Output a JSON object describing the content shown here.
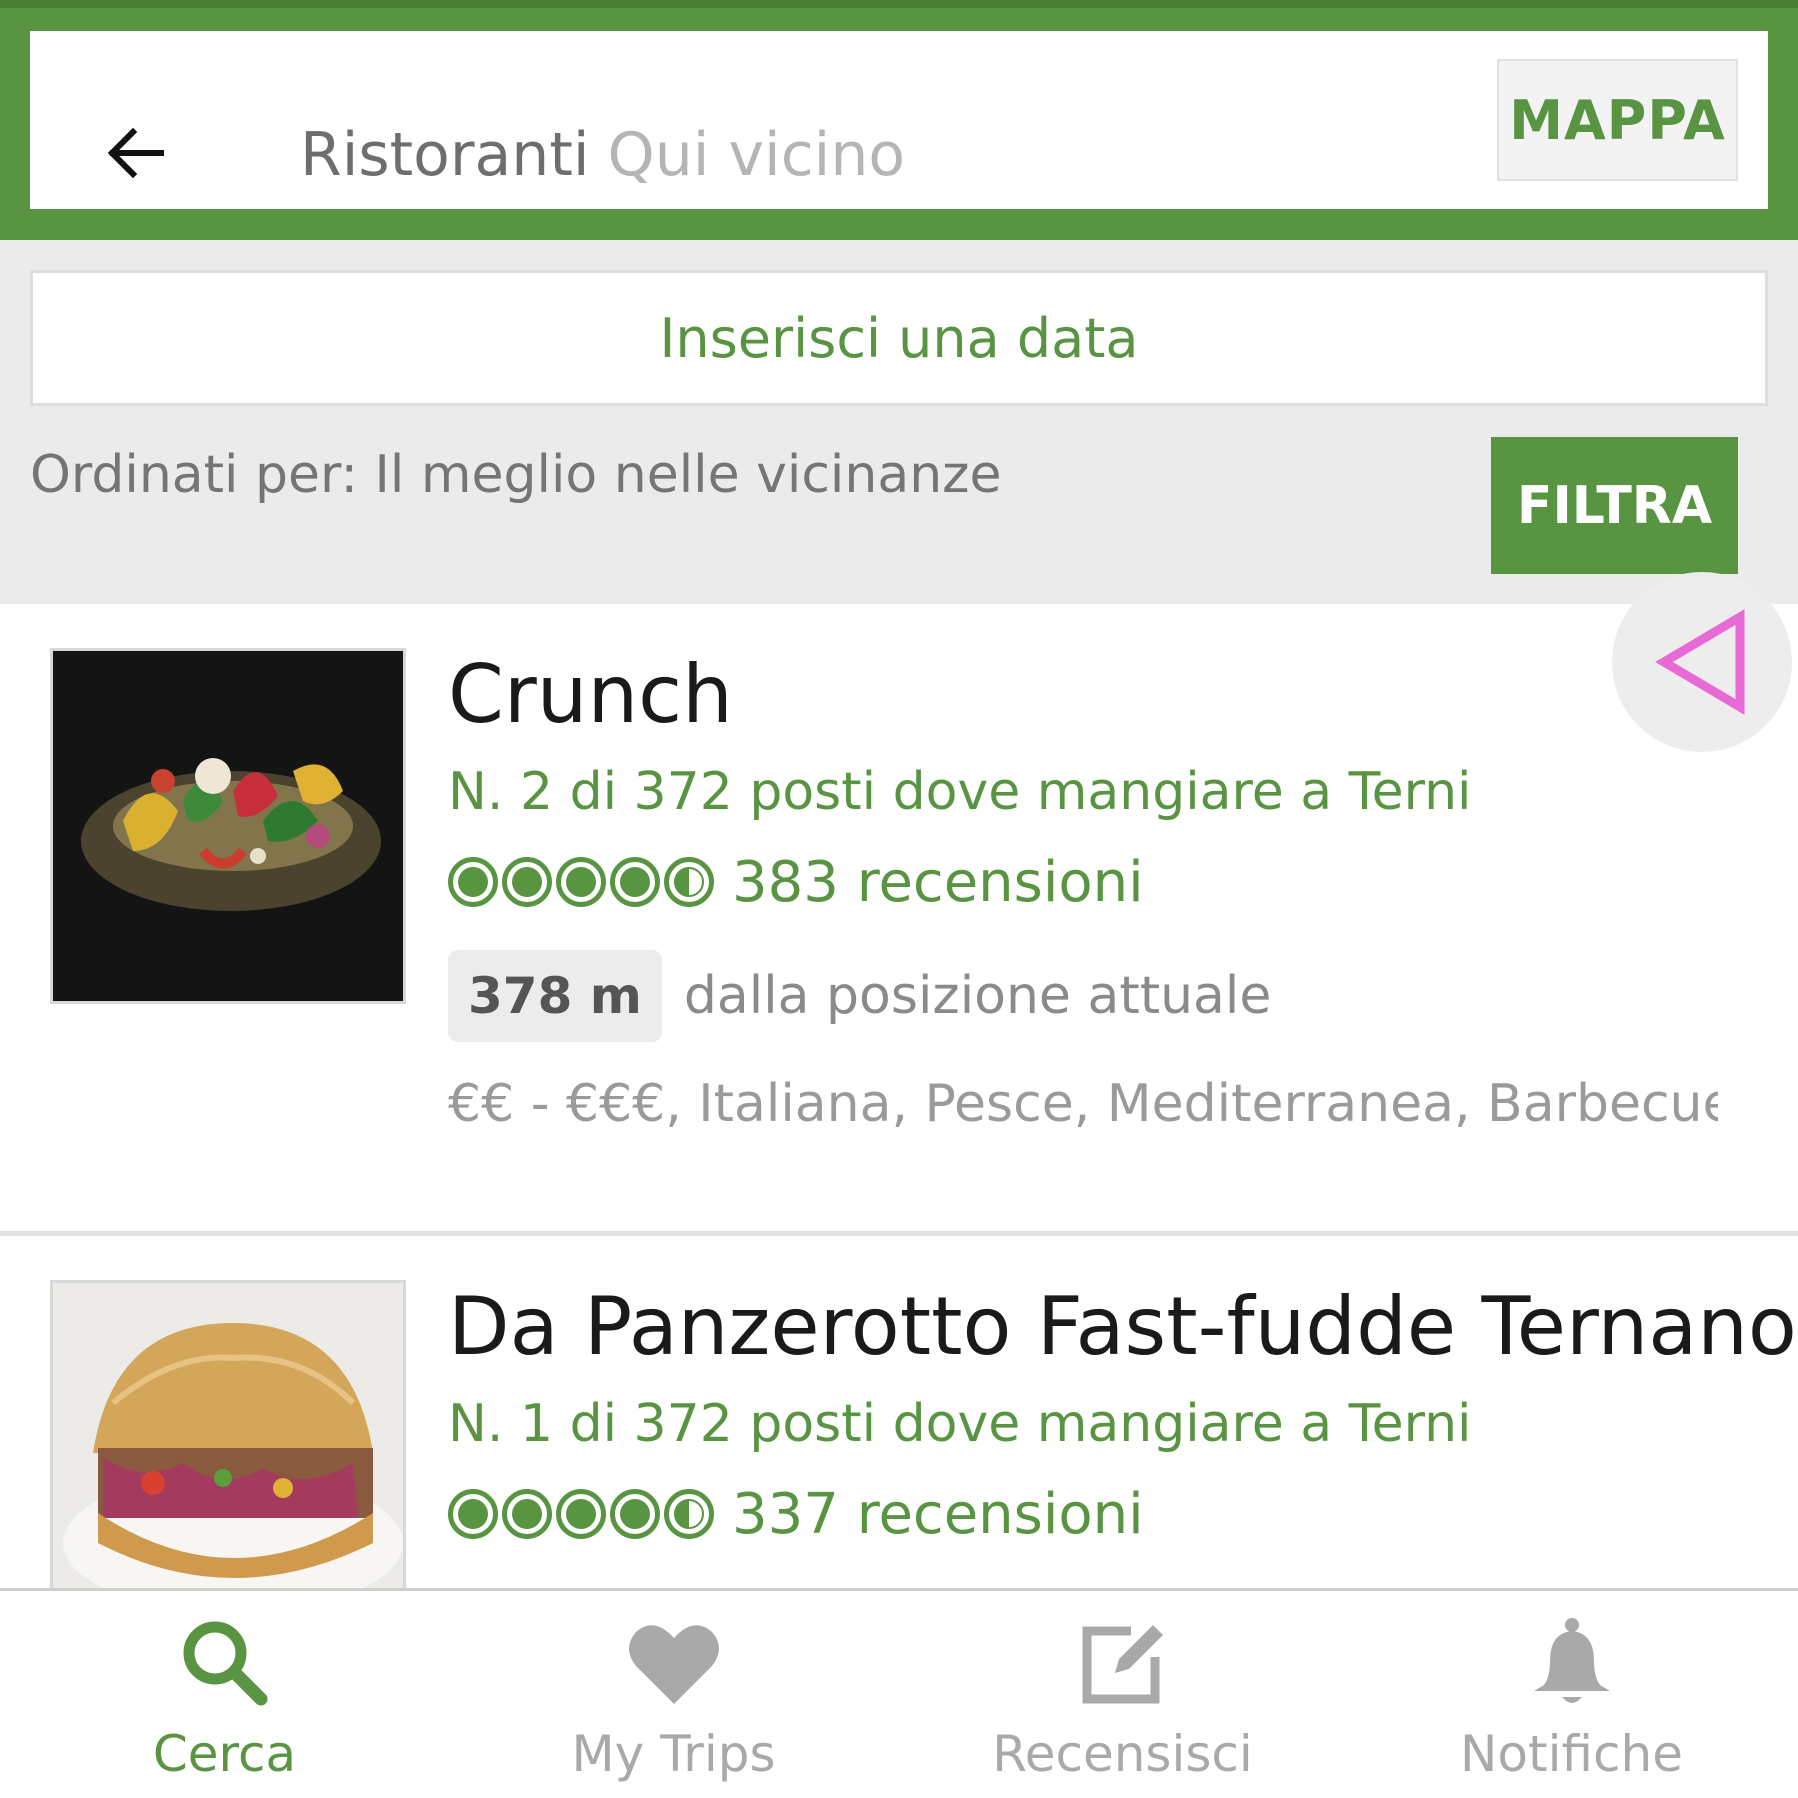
{
  "header": {
    "back_icon": "back-arrow-icon",
    "search_category": "Ristoranti",
    "search_location": "Qui vicino",
    "map_button": "MAPPA"
  },
  "date_prompt": "Inserisci una data",
  "sort": {
    "label": "Ordinati per: Il meglio nelle vicinanze",
    "filter_button": "FILTRA"
  },
  "restaurants": [
    {
      "name": "Crunch",
      "rank": "N. 2 di 372 posti dove mangiare a Terni",
      "rating": 4.5,
      "reviews": "383 recensioni",
      "distance": "378 m",
      "distance_label": "dalla posizione attuale",
      "cuisine": "€€ - €€€, Italiana, Pesce, Mediterranea, Barbecue,..."
    },
    {
      "name": "Da Panzerotto Fast-fudde Ternano",
      "rank": "N. 1 di 372 posti dove mangiare a Terni",
      "rating": 4.5,
      "reviews": "337 recensioni"
    }
  ],
  "share_icon": "share-triangle-icon",
  "bottom_nav": [
    {
      "label": "Cerca",
      "icon": "search-icon",
      "active": true
    },
    {
      "label": "My Trips",
      "icon": "heart-icon",
      "active": false
    },
    {
      "label": "Recensisci",
      "icon": "edit-icon",
      "active": false
    },
    {
      "label": "Notifiche",
      "icon": "bell-icon",
      "active": false
    }
  ],
  "colors": {
    "brand_green": "#589442",
    "share_pink": "#e86ad6"
  }
}
